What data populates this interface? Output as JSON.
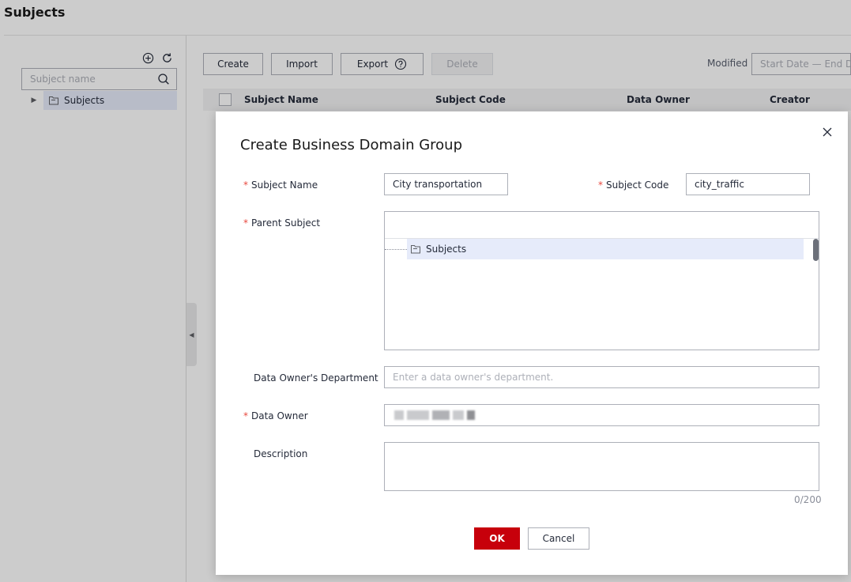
{
  "page": {
    "title": "Subjects"
  },
  "tree": {
    "search_placeholder": "Subject name",
    "root_label": "Subjects"
  },
  "toolbar": {
    "create_label": "Create",
    "import_label": "Import",
    "export_label": "Export",
    "delete_label": "Delete",
    "modified_label": "Modified",
    "date_placeholder": "Start Date — End Date"
  },
  "table": {
    "columns": [
      "Subject Name",
      "Subject Code",
      "Data Owner",
      "Creator"
    ]
  },
  "dialog": {
    "title": "Create Business Domain Group",
    "required_mark": "*",
    "subject_name_label": "Subject Name",
    "subject_name_value": "City transportation",
    "subject_code_label": "Subject Code",
    "subject_code_value": "city_traffic",
    "parent_subject_label": "Parent Subject",
    "parent_subject_option": "Subjects",
    "dept_label": "Data Owner's Department",
    "dept_placeholder": "Enter a data owner's department.",
    "data_owner_label": "Data Owner",
    "description_label": "Description",
    "description_counter": "0/200",
    "ok_label": "OK",
    "cancel_label": "Cancel"
  },
  "colors": {
    "accent": "#c7000b",
    "selection": "#e6ebfa",
    "required": "#e8483e"
  },
  "icons": [
    "add-circle-icon",
    "refresh-icon",
    "search-icon",
    "caret-right-icon",
    "folder-icon",
    "help-icon",
    "close-icon",
    "collapse-left-icon"
  ]
}
